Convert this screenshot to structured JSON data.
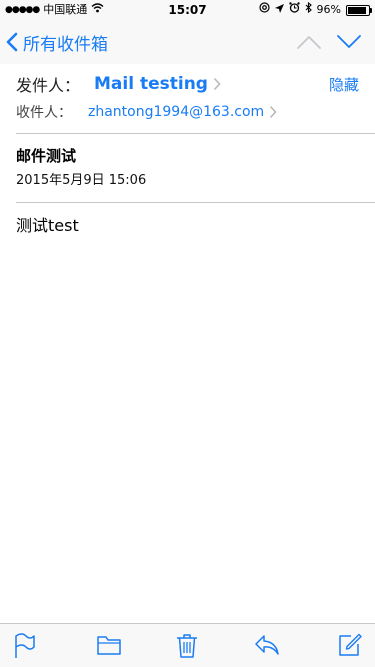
{
  "status_bar": {
    "signal": "●●●●●",
    "carrier": "中国联通",
    "time": "15:07",
    "battery": "96%",
    "battery_level": 0.96
  },
  "nav": {
    "back_label": "所有收件箱"
  },
  "email": {
    "from_label": "发件人：",
    "from_name": "Mail testing",
    "hide_label": "隐藏",
    "to_label": "收件人：",
    "to_address": "zhantong1994@163.com",
    "subject": "邮件测试",
    "date": "2015年5月9日 15:06",
    "body": "测试test"
  },
  "colors": {
    "accent": "#1a7cf4",
    "separator": "#c8c7cc",
    "bar_background": "#f8f8f8"
  },
  "icons": [
    "wifi-icon",
    "at-icon",
    "location-icon",
    "alarm-icon",
    "bluetooth-icon",
    "battery-icon",
    "back-chevron-icon",
    "up-arrow-icon",
    "down-arrow-icon",
    "flag-icon",
    "folder-icon",
    "trash-icon",
    "reply-icon",
    "compose-icon"
  ]
}
